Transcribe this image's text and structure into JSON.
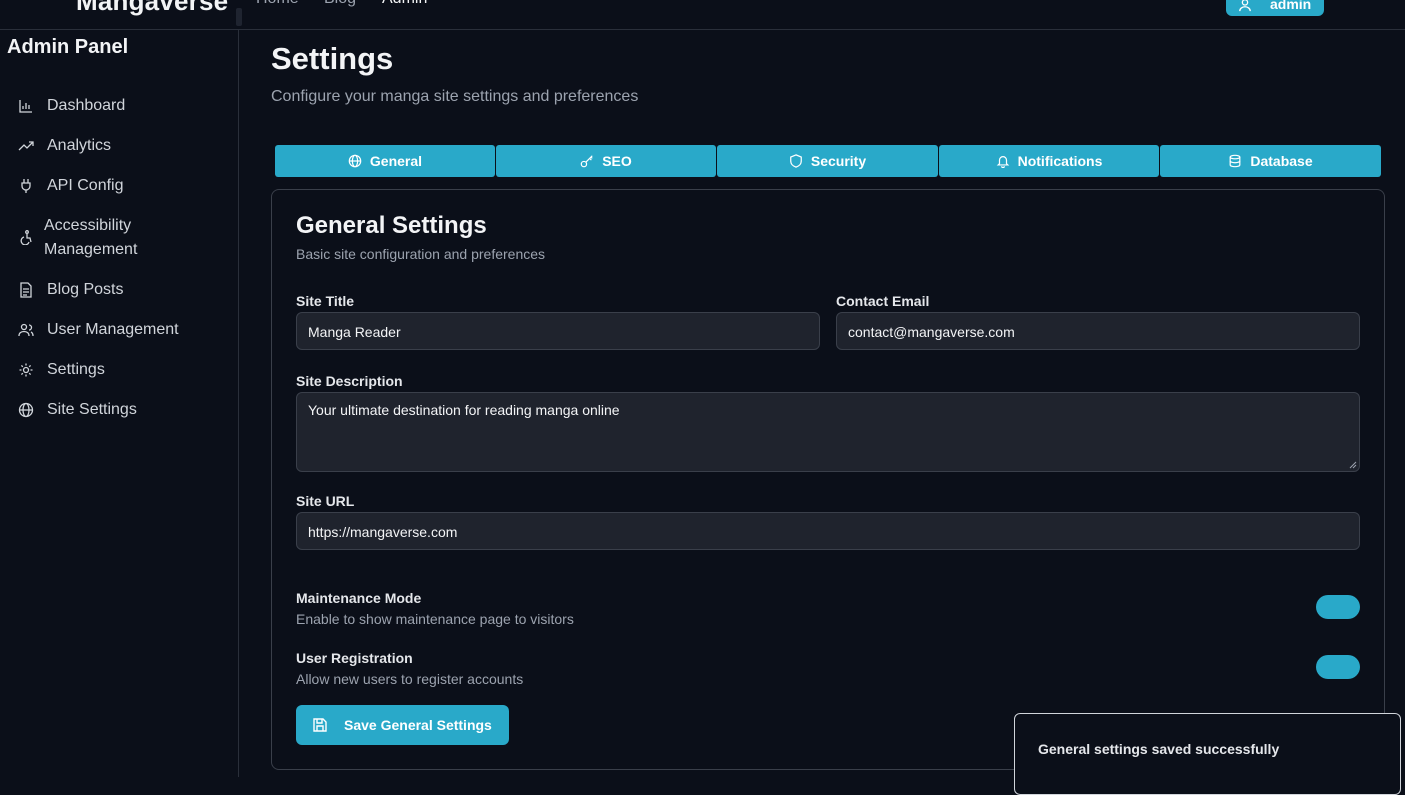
{
  "nav": {
    "brand": "Mangaverse",
    "links": [
      "Home",
      "Blog",
      "Admin"
    ],
    "user_label": "admin"
  },
  "sidebar": {
    "title": "Admin Panel",
    "items": [
      {
        "label": "Dashboard",
        "icon": "bar-chart-icon"
      },
      {
        "label": "Analytics",
        "icon": "trending-up-icon"
      },
      {
        "label": "API Config",
        "icon": "plug-icon"
      },
      {
        "label": "Accessibility Management",
        "icon": "accessibility-icon"
      },
      {
        "label": "Blog Posts",
        "icon": "file-text-icon"
      },
      {
        "label": "User Management",
        "icon": "users-icon"
      },
      {
        "label": "Settings",
        "icon": "gear-icon"
      },
      {
        "label": "Site Settings",
        "icon": "globe-icon"
      }
    ]
  },
  "page": {
    "title": "Settings",
    "subtitle": "Configure your manga site settings and preferences"
  },
  "tabs": [
    {
      "label": "General",
      "icon": "globe-icon"
    },
    {
      "label": "SEO",
      "icon": "key-icon"
    },
    {
      "label": "Security",
      "icon": "shield-icon"
    },
    {
      "label": "Notifications",
      "icon": "bell-icon"
    },
    {
      "label": "Database",
      "icon": "database-icon"
    }
  ],
  "card": {
    "title": "General Settings",
    "subtitle": "Basic site configuration and preferences",
    "site_title_label": "Site Title",
    "site_title_value": "Manga Reader",
    "contact_email_label": "Contact Email",
    "contact_email_value": "contact@mangaverse.com",
    "site_description_label": "Site Description",
    "site_description_value": "Your ultimate destination for reading manga online",
    "site_url_label": "Site URL",
    "site_url_value": "https://mangaverse.com",
    "maintenance_label": "Maintenance Mode",
    "maintenance_desc": "Enable to show maintenance page to visitors",
    "registration_label": "User Registration",
    "registration_desc": "Allow new users to register accounts",
    "save_label": "Save General Settings"
  },
  "toast": {
    "message": "General settings saved successfully"
  },
  "colors": {
    "accent": "#29a9c9",
    "background": "#0b0f19",
    "input_bg": "#1f232d"
  }
}
